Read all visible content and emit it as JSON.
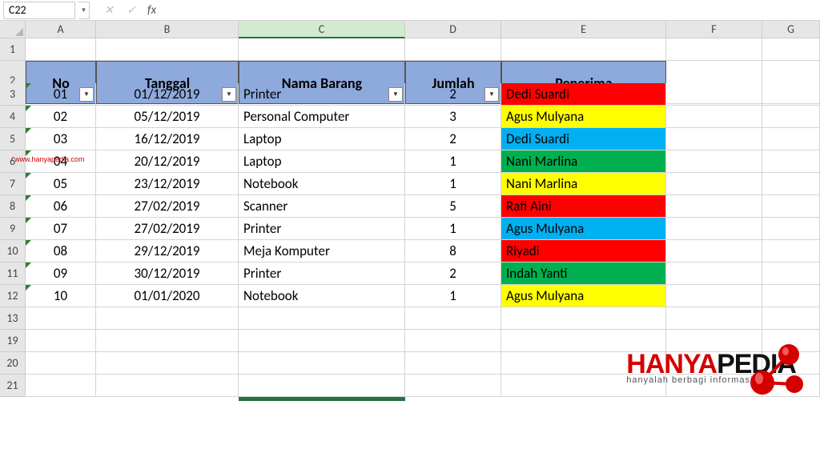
{
  "namebox": "C22",
  "formula_value": "",
  "col_headers": [
    "A",
    "B",
    "C",
    "D",
    "E",
    "F",
    "G"
  ],
  "row_headers_top": [
    "1"
  ],
  "header_row_label": "2",
  "headers": {
    "no": "No",
    "tanggal": "Tanggal",
    "nama": "Nama Barang",
    "jumlah": "Jumlah",
    "penerima": "Penerima"
  },
  "rows": [
    {
      "rh": "3",
      "no": "01",
      "tgl": "01/12/2019",
      "nama": "Printer",
      "jml": "2",
      "pen": "Dedi Suardi",
      "clr": "#ff0000"
    },
    {
      "rh": "4",
      "no": "02",
      "tgl": "05/12/2019",
      "nama": "Personal Computer",
      "jml": "3",
      "pen": "Agus Mulyana",
      "clr": "#ffff00"
    },
    {
      "rh": "5",
      "no": "03",
      "tgl": "16/12/2019",
      "nama": "Laptop",
      "jml": "2",
      "pen": "Dedi Suardi",
      "clr": "#00b0f0"
    },
    {
      "rh": "6",
      "no": "04",
      "tgl": "20/12/2019",
      "nama": "Laptop",
      "jml": "1",
      "pen": "Nani Marlina",
      "clr": "#00b050"
    },
    {
      "rh": "7",
      "no": "05",
      "tgl": "23/12/2019",
      "nama": "Notebook",
      "jml": "1",
      "pen": "Nani Marlina",
      "clr": "#ffff00"
    },
    {
      "rh": "8",
      "no": "06",
      "tgl": "27/02/2019",
      "nama": "Scanner",
      "jml": "5",
      "pen": "Rafi Aini",
      "clr": "#ff0000"
    },
    {
      "rh": "9",
      "no": "07",
      "tgl": "27/02/2019",
      "nama": "Printer",
      "jml": "1",
      "pen": "Agus Mulyana",
      "clr": "#00b0f0"
    },
    {
      "rh": "10",
      "no": "08",
      "tgl": "29/12/2019",
      "nama": "Meja Komputer",
      "jml": "8",
      "pen": "Riyadi",
      "clr": "#ff0000"
    },
    {
      "rh": "11",
      "no": "09",
      "tgl": "30/12/2019",
      "nama": "Printer",
      "jml": "2",
      "pen": "Indah Yanti",
      "clr": "#00b050"
    },
    {
      "rh": "12",
      "no": "10",
      "tgl": "01/01/2020",
      "nama": "Notebook",
      "jml": "1",
      "pen": "Agus Mulyana",
      "clr": "#ffff00"
    }
  ],
  "tail_rows": [
    "13",
    "19",
    "20",
    "21"
  ],
  "watermark": "www.hanyapedia.com",
  "logo": {
    "part1": "HANYA",
    "part2": "PEDIA",
    "sub": "hanyalah berbagi informasi"
  }
}
